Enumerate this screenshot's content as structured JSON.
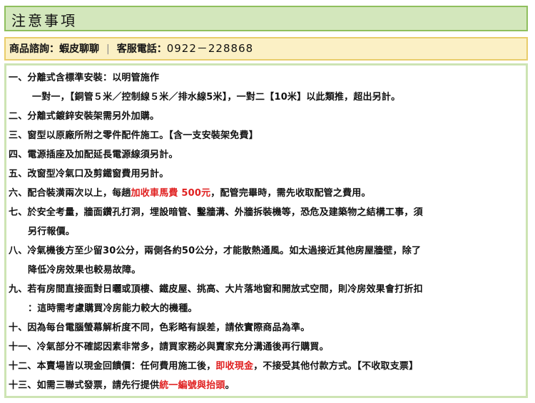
{
  "title": "注意事項",
  "contact": {
    "consult_label": "商品諮詢：",
    "consult_value": "蝦皮聊聊",
    "separator": "|",
    "service_label": "客服電話：",
    "service_phone": "0922－228868"
  },
  "notes": [
    {
      "text": "一、分離式含標準安裝：以明管施作"
    },
    {
      "text": "一對一，【銅管５米／控制線５米／排水線5米】，一對二【10米】以此類推，超出另計。"
    },
    {
      "text": "二、分離式鍍鋅安裝架需另外加購。"
    },
    {
      "text": "三、窗型以原廠所附之零件配件施工。【含一支安裝架免費】"
    },
    {
      "text": "四、電源插座及加配延長電源線須另計。"
    },
    {
      "text": "五、改窗型冷氣口及剪鐵窗費用另計。"
    },
    {
      "before": "六、配合裝潢兩次以上，每趟",
      "highlight": "加收車馬費 500元",
      "after": "，配管完畢時，需先收取配管之費用。"
    },
    {
      "text": "七、於安全考量，牆面鑽孔打洞，埋設暗管、鑿牆溝、外牆拆裝機等，恐危及建築物之結構工事，須"
    },
    {
      "text": "另行報價。"
    },
    {
      "text": "八、冷氣機後方至少留30公分，兩側各約50公分，才能散熱通風。如太過接近其他房屋牆壁，除了"
    },
    {
      "text": "降低冷房效果也較易故障。"
    },
    {
      "text": "九、若有房間直接面對日曬或頂樓、鐵皮屋、挑高、大片落地窗和開放式空間，則冷房效果會打折扣"
    },
    {
      "text": "：這時需考慮購買冷房能力較大的機種。"
    },
    {
      "text": "十、因為每台電腦螢幕解析度不同，色彩略有誤差，請依實際商品為準。"
    },
    {
      "text": "十一、冷氣部分不確認因素非常多，請買家務必與賣家充分溝通後再行購買。"
    },
    {
      "before": "十二、本賣場皆以現金回饋價：任何費用施工後，",
      "highlight": "即收現金",
      "after": "，不接受其他付款方式。【不收取支票】"
    },
    {
      "before": "十三、如需三聯式發票，請先行提供",
      "highlight": "統一編號與抬頭",
      "after": "。"
    }
  ]
}
